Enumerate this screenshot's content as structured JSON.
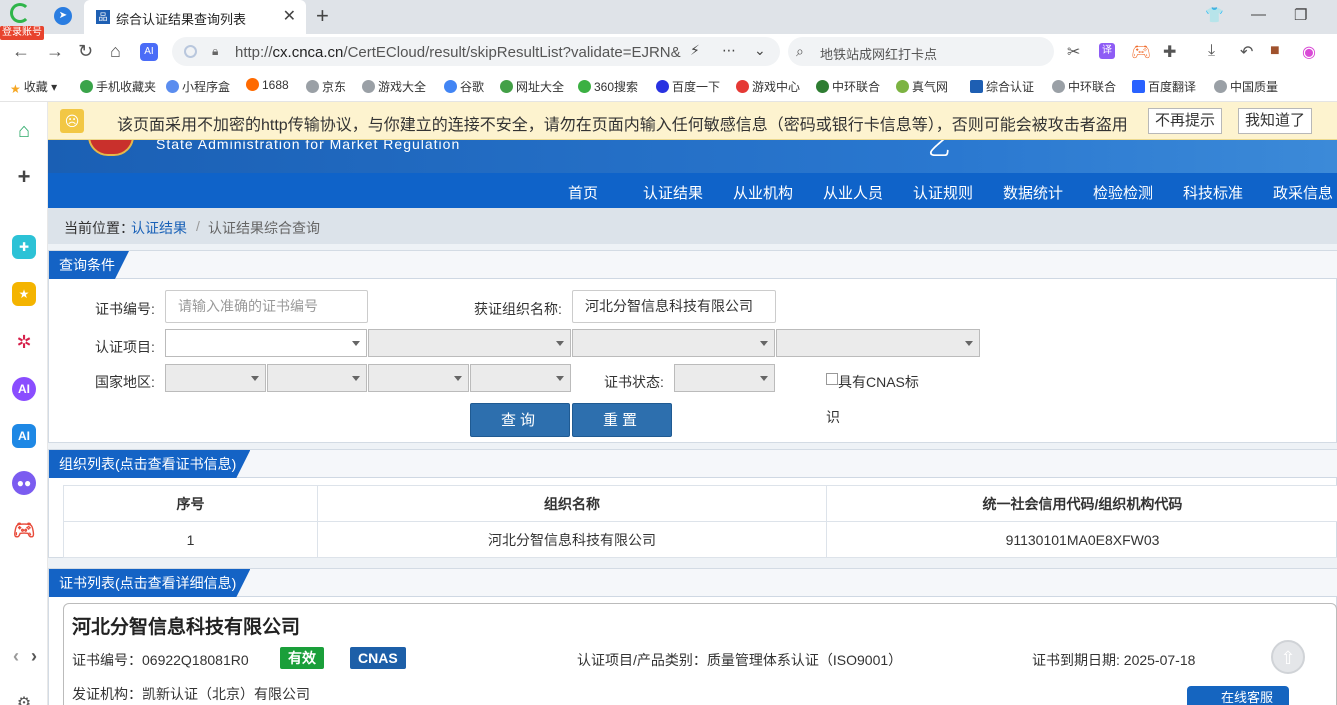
{
  "browser": {
    "login_badge": "登录账号",
    "tab_title": "综合认证结果查询列表",
    "tab_favicon_text": "品",
    "url_prefix": "http://",
    "url_host": "cx.cnca.cn",
    "url_rest": "/CertECloud/result/skipResultList?validate=EJRN&",
    "search_text": "地铁站成网红打卡点",
    "bookmarks": [
      {
        "label": "收藏",
        "color": "#f5a623"
      },
      {
        "label": "手机收藏夹",
        "color": "#3aa44a"
      },
      {
        "label": "小程序盒",
        "color": "#5b8def"
      },
      {
        "label": "1688",
        "color": "#ff6a00"
      },
      {
        "label": "京东",
        "color": "#9aa0a6"
      },
      {
        "label": "游戏大全",
        "color": "#9aa0a6"
      },
      {
        "label": "谷歌",
        "color": "#4285f4"
      },
      {
        "label": "网址大全",
        "color": "#43a047"
      },
      {
        "label": "360搜索",
        "color": "#3cb043"
      },
      {
        "label": "百度一下",
        "color": "#2932e1"
      },
      {
        "label": "游戏中心",
        "color": "#e53935"
      },
      {
        "label": "中环联合",
        "color": "#2e7d32"
      },
      {
        "label": "真气网",
        "color": "#7cb342"
      },
      {
        "label": "综合认证",
        "color": "#1e5fb3"
      },
      {
        "label": "中环联合",
        "color": "#9aa0a6"
      },
      {
        "label": "百度翻译",
        "color": "#2962ff"
      },
      {
        "label": "中国质量",
        "color": "#9aa0a6"
      }
    ]
  },
  "warning": {
    "text": "该页面采用不加密的http传输协议，与你建立的连接不安全，请勿在页面内输入任何敏感信息（密码或银行卡信息等），否则可能会被攻击者盗用",
    "dismiss_label": "不再提示",
    "ok_label": "我知道了"
  },
  "site": {
    "banner_en": "State Administration for Market Regulation",
    "nav": [
      "首页",
      "认证结果",
      "从业机构",
      "从业人员",
      "认证规则",
      "数据统计",
      "检验检测",
      "科技标准",
      "政采信息"
    ],
    "breadcrumb": {
      "prefix": "当前位置：",
      "level1": "认证结果",
      "sep": "/",
      "level2": "认证结果综合查询"
    }
  },
  "query": {
    "panel_title": "查询条件",
    "cert_no_label": "证书编号:",
    "cert_no_placeholder": "请输入准确的证书编号",
    "org_name_label": "获证组织名称:",
    "org_name_value": "河北分智信息科技有限公司",
    "project_label": "认证项目:",
    "region_label": "国家地区:",
    "status_label": "证书状态:",
    "cnas_label_line1": "具有CNAS标",
    "cnas_label_line2": "识",
    "search_btn": "查询",
    "reset_btn": "重置"
  },
  "org_list": {
    "panel_title": "组织列表(点击查看证书信息)",
    "columns": [
      "序号",
      "组织名称",
      "统一社会信用代码/组织机构代码"
    ],
    "rows": [
      [
        "1",
        "河北分智信息科技有限公司",
        "91130101MA0E8XFW03"
      ]
    ]
  },
  "cert_list": {
    "panel_title": "证书列表(点击查看详细信息)",
    "org_name": "河北分智信息科技有限公司",
    "cert_no": "证书编号：06922Q18081R0",
    "status_badge": "有效",
    "cnas_badge": "CNAS",
    "project": "认证项目/产品类别：质量管理体系认证（ISO9001）",
    "expiry": "证书到期日期: 2025-07-18",
    "issuer": "发证机构：凯新认证（北京）有限公司",
    "service_label": "在线客服"
  }
}
